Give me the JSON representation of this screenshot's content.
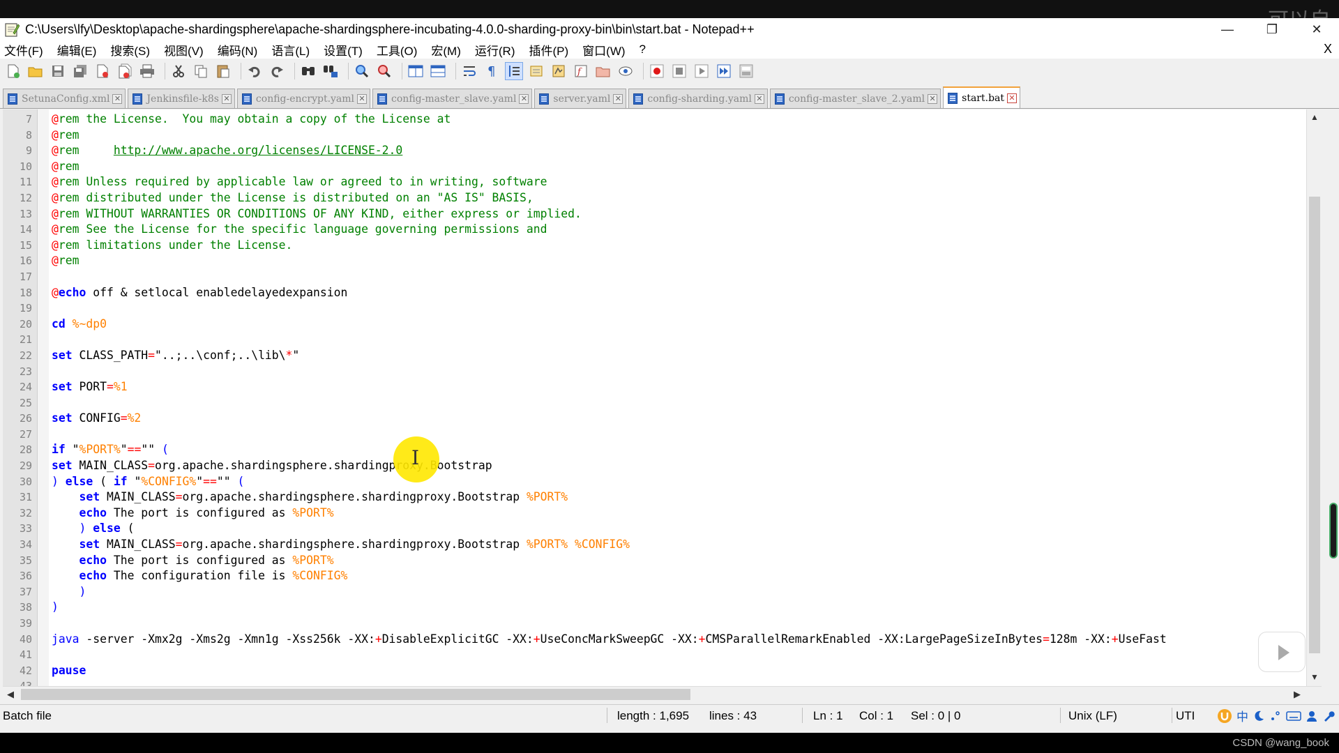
{
  "overlay": {
    "watermark_top_right": "可以自",
    "csdn_watermark": "CSDN @wang_book"
  },
  "window": {
    "title": "C:\\Users\\lfy\\Desktop\\apache-shardingsphere\\apache-shardingsphere-incubating-4.0.0-sharding-proxy-bin\\bin\\start.bat - Notepad++",
    "controls": {
      "minimize": "—",
      "restore": "❐",
      "close": "✕"
    }
  },
  "menu": {
    "items": [
      "文件(F)",
      "编辑(E)",
      "搜索(S)",
      "视图(V)",
      "编码(N)",
      "语言(L)",
      "设置(T)",
      "工具(O)",
      "宏(M)",
      "运行(R)",
      "插件(P)",
      "窗口(W)",
      "?"
    ],
    "close_doc": "X"
  },
  "toolbar": {
    "buttons": [
      "new-file",
      "open-file",
      "save",
      "save-all",
      "close",
      "close-all",
      "print",
      "cut",
      "copy",
      "paste",
      "undo",
      "redo",
      "find",
      "replace",
      "zoom-in",
      "zoom-out",
      "sync-vertical",
      "sync-horizontal",
      "word-wrap",
      "show-all-chars",
      "indent-guide",
      "user-defined-language",
      "document-map",
      "function-list",
      "folder-as-workspace",
      "monitoring",
      "record-macro",
      "stop-recording",
      "playback-macro",
      "run-macro-multiple",
      "save-macro"
    ]
  },
  "tabs": [
    {
      "label": "SetunaConfig.xml",
      "active": false
    },
    {
      "label": "Jenkinsfile-k8s",
      "active": false
    },
    {
      "label": "config-encrypt.yaml",
      "active": false
    },
    {
      "label": "config-master_slave.yaml",
      "active": false
    },
    {
      "label": "server.yaml",
      "active": false
    },
    {
      "label": "config-sharding.yaml",
      "active": false
    },
    {
      "label": "config-master_slave_2.yaml",
      "active": false
    },
    {
      "label": "start.bat",
      "active": true
    }
  ],
  "editor": {
    "lines": [
      {
        "n": "7",
        "segs": [
          [
            "at",
            "@"
          ],
          [
            "cmt",
            "rem the License.  You may obtain a copy of the License at"
          ]
        ]
      },
      {
        "n": "8",
        "segs": [
          [
            "at",
            "@"
          ],
          [
            "cmt",
            "rem"
          ]
        ]
      },
      {
        "n": "9",
        "segs": [
          [
            "at",
            "@"
          ],
          [
            "cmt",
            "rem     "
          ],
          [
            "link",
            "http://www.apache.org/licenses/LICENSE-2.0"
          ]
        ]
      },
      {
        "n": "10",
        "segs": [
          [
            "at",
            "@"
          ],
          [
            "cmt",
            "rem"
          ]
        ]
      },
      {
        "n": "11",
        "segs": [
          [
            "at",
            "@"
          ],
          [
            "cmt",
            "rem Unless required by applicable law or agreed to in writing, software"
          ]
        ]
      },
      {
        "n": "12",
        "segs": [
          [
            "at",
            "@"
          ],
          [
            "cmt",
            "rem distributed under the License is distributed on an \"AS IS\" BASIS,"
          ]
        ]
      },
      {
        "n": "13",
        "segs": [
          [
            "at",
            "@"
          ],
          [
            "cmt",
            "rem WITHOUT WARRANTIES OR CONDITIONS OF ANY KIND, either express or implied."
          ]
        ]
      },
      {
        "n": "14",
        "segs": [
          [
            "at",
            "@"
          ],
          [
            "cmt",
            "rem See the License for the specific language governing permissions and"
          ]
        ]
      },
      {
        "n": "15",
        "segs": [
          [
            "at",
            "@"
          ],
          [
            "cmt",
            "rem limitations under the License."
          ]
        ]
      },
      {
        "n": "16",
        "segs": [
          [
            "at",
            "@"
          ],
          [
            "cmt",
            "rem"
          ]
        ]
      },
      {
        "n": "17",
        "segs": []
      },
      {
        "n": "18",
        "segs": [
          [
            "at",
            "@"
          ],
          [
            "kw",
            "echo"
          ],
          [
            "plain",
            " off & setlocal enabledelayedexpansion"
          ]
        ]
      },
      {
        "n": "19",
        "segs": []
      },
      {
        "n": "20",
        "segs": [
          [
            "kw",
            "cd"
          ],
          [
            "plain",
            " "
          ],
          [
            "var",
            "%~dp0"
          ]
        ]
      },
      {
        "n": "21",
        "segs": []
      },
      {
        "n": "22",
        "segs": [
          [
            "kw",
            "set"
          ],
          [
            "plain",
            " CLASS_PATH"
          ],
          [
            "op",
            "="
          ],
          [
            "plain",
            "\"..;..\\conf;..\\lib\\"
          ],
          [
            "op",
            "*"
          ],
          [
            "plain",
            "\""
          ]
        ]
      },
      {
        "n": "23",
        "segs": []
      },
      {
        "n": "24",
        "segs": [
          [
            "kw",
            "set"
          ],
          [
            "plain",
            " PORT"
          ],
          [
            "op",
            "="
          ],
          [
            "var",
            "%1"
          ]
        ]
      },
      {
        "n": "25",
        "segs": []
      },
      {
        "n": "26",
        "segs": [
          [
            "kw",
            "set"
          ],
          [
            "plain",
            " CONFIG"
          ],
          [
            "op",
            "="
          ],
          [
            "var",
            "%2"
          ]
        ]
      },
      {
        "n": "27",
        "segs": []
      },
      {
        "n": "28",
        "segs": [
          [
            "kw",
            "if"
          ],
          [
            "plain",
            " \""
          ],
          [
            "var",
            "%PORT%"
          ],
          [
            "plain",
            "\""
          ],
          [
            "op",
            "=="
          ],
          [
            "plain",
            "\"\" "
          ],
          [
            "brace",
            "("
          ]
        ]
      },
      {
        "n": "29",
        "segs": [
          [
            "kw",
            "set"
          ],
          [
            "plain",
            " MAIN_CLASS"
          ],
          [
            "op",
            "="
          ],
          [
            "plain",
            "org.apache.shardingsphere.shardingproxy.Bootstrap"
          ]
        ]
      },
      {
        "n": "30",
        "segs": [
          [
            "brace",
            ")"
          ],
          [
            "plain",
            " "
          ],
          [
            "kw",
            "else"
          ],
          [
            "plain",
            " ( "
          ],
          [
            "kw",
            "if"
          ],
          [
            "plain",
            " \""
          ],
          [
            "var",
            "%CONFIG%"
          ],
          [
            "plain",
            "\""
          ],
          [
            "op",
            "=="
          ],
          [
            "plain",
            "\"\" "
          ],
          [
            "brace",
            "("
          ]
        ]
      },
      {
        "n": "31",
        "segs": [
          [
            "plain",
            "    "
          ],
          [
            "kw",
            "set"
          ],
          [
            "plain",
            " MAIN_CLASS"
          ],
          [
            "op",
            "="
          ],
          [
            "plain",
            "org.apache.shardingsphere.shardingproxy.Bootstrap "
          ],
          [
            "var",
            "%PORT%"
          ]
        ]
      },
      {
        "n": "32",
        "segs": [
          [
            "plain",
            "    "
          ],
          [
            "kw",
            "echo"
          ],
          [
            "plain",
            " The port is configured as "
          ],
          [
            "var",
            "%PORT%"
          ]
        ]
      },
      {
        "n": "33",
        "segs": [
          [
            "plain",
            "    "
          ],
          [
            "brace",
            ")"
          ],
          [
            "plain",
            " "
          ],
          [
            "kw",
            "else"
          ],
          [
            "plain",
            " ("
          ]
        ]
      },
      {
        "n": "34",
        "segs": [
          [
            "plain",
            "    "
          ],
          [
            "kw",
            "set"
          ],
          [
            "plain",
            " MAIN_CLASS"
          ],
          [
            "op",
            "="
          ],
          [
            "plain",
            "org.apache.shardingsphere.shardingproxy.Bootstrap "
          ],
          [
            "var",
            "%PORT%"
          ],
          [
            "plain",
            " "
          ],
          [
            "var",
            "%CONFIG%"
          ]
        ]
      },
      {
        "n": "35",
        "segs": [
          [
            "plain",
            "    "
          ],
          [
            "kw",
            "echo"
          ],
          [
            "plain",
            " The port is configured as "
          ],
          [
            "var",
            "%PORT%"
          ]
        ]
      },
      {
        "n": "36",
        "segs": [
          [
            "plain",
            "    "
          ],
          [
            "kw",
            "echo"
          ],
          [
            "plain",
            " The configuration file is "
          ],
          [
            "var",
            "%CONFIG%"
          ]
        ]
      },
      {
        "n": "37",
        "segs": [
          [
            "plain",
            "    "
          ],
          [
            "brace",
            ")"
          ]
        ]
      },
      {
        "n": "38",
        "segs": [
          [
            "brace",
            ")"
          ]
        ]
      },
      {
        "n": "39",
        "segs": []
      },
      {
        "n": "40",
        "segs": [
          [
            "java",
            "java"
          ],
          [
            "plain",
            " -server -Xmx2g -Xms2g -Xmn1g -Xss256k -XX:"
          ],
          [
            "op",
            "+"
          ],
          [
            "plain",
            "DisableExplicitGC -XX:"
          ],
          [
            "op",
            "+"
          ],
          [
            "plain",
            "UseConcMarkSweepGC -XX:"
          ],
          [
            "op",
            "+"
          ],
          [
            "plain",
            "CMSParallelRemarkEnabled -XX:LargePageSizeInBytes"
          ],
          [
            "op",
            "="
          ],
          [
            "plain",
            "128m -XX:"
          ],
          [
            "op",
            "+"
          ],
          [
            "plain",
            "UseFast"
          ]
        ]
      },
      {
        "n": "41",
        "segs": []
      },
      {
        "n": "42",
        "segs": [
          [
            "kw",
            "pause"
          ]
        ]
      },
      {
        "n": "43",
        "segs": []
      }
    ]
  },
  "status": {
    "file_type": "Batch file",
    "length": "length : 1,695",
    "lines": "lines : 43",
    "ln": "Ln : 1",
    "col": "Col : 1",
    "sel": "Sel : 0 | 0",
    "eol": "Unix (LF)",
    "encoding": "UTI",
    "ime_items": [
      "中"
    ]
  },
  "colors": {
    "comment": "#008000",
    "keyword": "#0000ff",
    "variable": "#ff8000",
    "operator": "#ff0000",
    "active_tab_accent": "#f2a23a",
    "tab_icon": "#2f66c0"
  }
}
